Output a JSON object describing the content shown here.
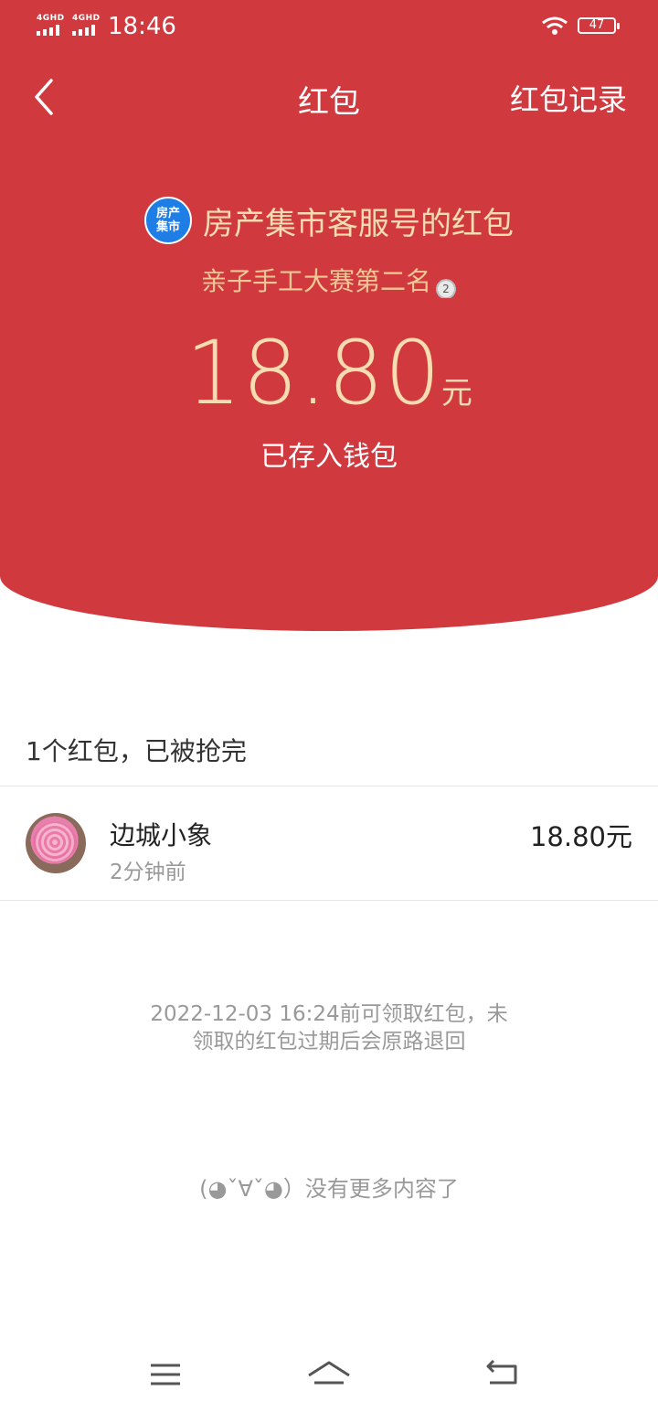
{
  "status_bar": {
    "signal1": "4GHD",
    "signal2": "4GHD",
    "time": "18:46",
    "battery": "47"
  },
  "nav": {
    "back_icon": "chevron-left-icon",
    "title": "红包",
    "records_label": "红包记录"
  },
  "packet": {
    "sender_logo_line1": "房产",
    "sender_logo_line2": "集市",
    "sender": "房产集市客服号的红包",
    "greeting": "亲子手工大赛第二名",
    "greeting_icon": "second-place-medal-icon",
    "amount": "18.80",
    "unit": "元",
    "status": "已存入钱包"
  },
  "summary": "1个红包，已被抢完",
  "recipients": [
    {
      "name": "边城小象",
      "time": "2分钟前",
      "amount": "18.80元"
    }
  ],
  "notice_line1": "2022-12-03 16:24前可领取红包，未",
  "notice_line2": "领取的红包过期后会原路退回",
  "no_more": "(◕ˇ∀ˇ◕）没有更多内容了",
  "colors": {
    "header_red": "#d03a3f",
    "gold_text": "#f6dcb0",
    "logo_blue": "#1f7ee6"
  },
  "system_nav": [
    "menu-icon",
    "home-icon",
    "back-icon"
  ]
}
